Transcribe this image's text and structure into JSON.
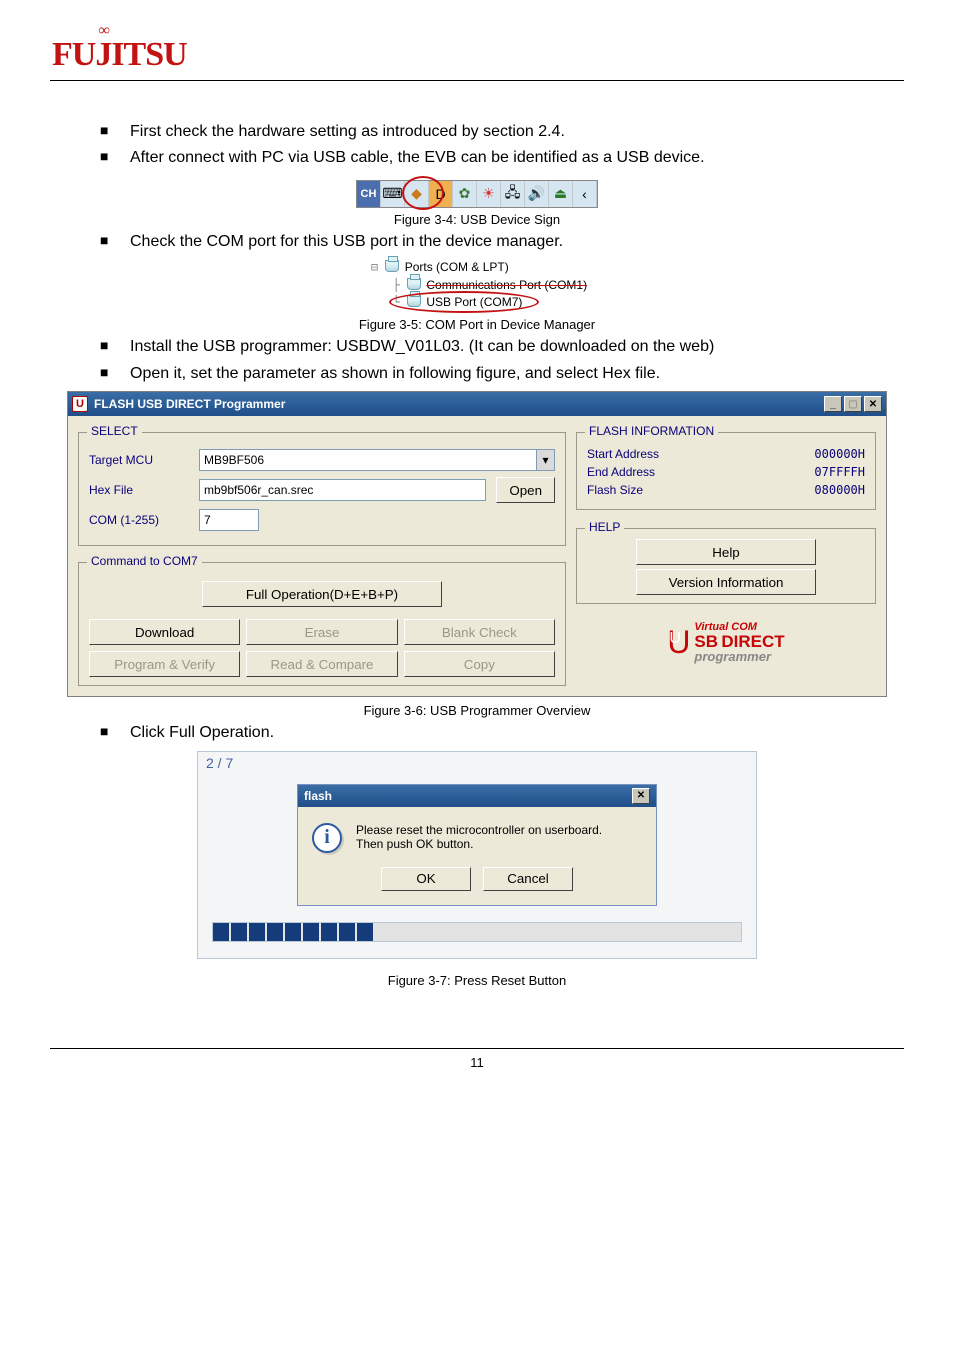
{
  "logo_text": "FUJITSU",
  "bullets": {
    "b1": "First check the hardware setting as introduced by section 2.4.",
    "b2": "After connect with PC via USB cable, the EVB can be identified as a USB device.",
    "b3": "Check the COM port for this USB port in the device manager.",
    "b4": "Install the USB programmer: USBDW_V01L03. (It can be downloaded on the web)",
    "b5": "Open it, set the parameter as shown in following figure, and select Hex file.",
    "b6": "Click Full Operation."
  },
  "figcaps": {
    "f34": "Figure 3-4: USB Device Sign",
    "f35": "Figure 3-5: COM Port in Device Manager",
    "f36": "Figure 3-6: USB Programmer Overview",
    "f37": "Figure 3-7: Press Reset Button"
  },
  "tray": {
    "ch": "CH"
  },
  "devmgr": {
    "node_ports": "Ports (COM & LPT)",
    "node_comm": "Communications Port (COM1)",
    "node_usb": "USB Port (COM7)"
  },
  "programmer": {
    "title": "FLASH USB DIRECT Programmer",
    "select": {
      "group": "SELECT",
      "target_label": "Target MCU",
      "target_value": "MB9BF506",
      "hex_label": "Hex File",
      "hex_value": "mb9bf506r_can.srec",
      "open": "Open",
      "com_label": "COM (1-255)",
      "com_value": "7"
    },
    "cmd": {
      "group_prefix": "Command to ",
      "group_port": "COM7",
      "fullop": "Full Operation(D+E+B+P)",
      "download": "Download",
      "erase": "Erase",
      "blank": "Blank Check",
      "progver": "Program & Verify",
      "readcmp": "Read & Compare",
      "copy": "Copy"
    },
    "info": {
      "group": "FLASH INFORMATION",
      "start_k": "Start Address",
      "start_v": "000000H",
      "end_k": "End Address",
      "end_v": "07FFFFH",
      "size_k": "Flash Size",
      "size_v": "080000H"
    },
    "help": {
      "group": "HELP",
      "help": "Help",
      "ver": "Version Information"
    },
    "usb_logo": {
      "virtual": "Virtual COM",
      "sb": "SB",
      "direct": "DIRECT",
      "programmer": "programmer"
    }
  },
  "dialog": {
    "counter": "2 / 7",
    "title": "flash",
    "msg1": "Please reset the microcontroller on userboard.",
    "msg2": "Then push OK button.",
    "ok": "OK",
    "cancel": "Cancel"
  },
  "page_number": "11"
}
